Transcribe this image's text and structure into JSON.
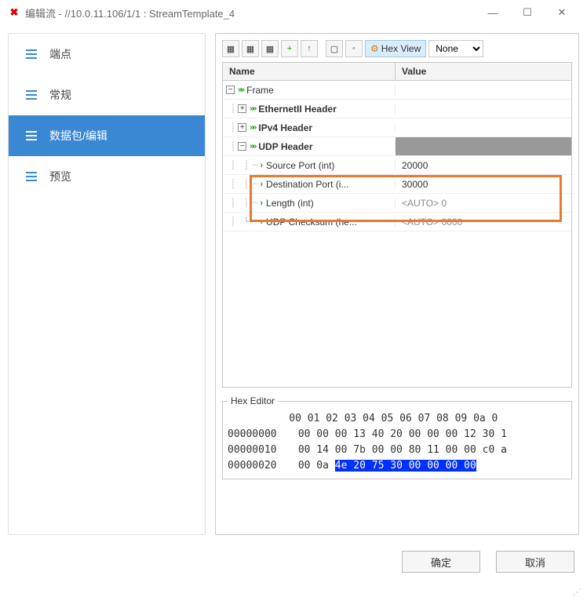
{
  "window": {
    "title": "编辑流 - //10.0.11.106/1/1 : StreamTemplate_4"
  },
  "sidebar": {
    "items": [
      {
        "label": "端点"
      },
      {
        "label": "常规"
      },
      {
        "label": "数据包/编辑"
      },
      {
        "label": "预览"
      }
    ]
  },
  "toolbar": {
    "hexview_label": "Hex View",
    "select_value": "None"
  },
  "table": {
    "headers": {
      "name": "Name",
      "value": "Value"
    },
    "rows": [
      {
        "indent": 0,
        "expander": "-",
        "chevrons": true,
        "name": "Frame",
        "value": "",
        "bold": false
      },
      {
        "indent": 1,
        "expander": "+",
        "chevrons": true,
        "name": "EthernetII Header",
        "value": "",
        "bold": true
      },
      {
        "indent": 1,
        "expander": "+",
        "chevrons": true,
        "name": "IPv4 Header",
        "value": "",
        "bold": true
      },
      {
        "indent": 1,
        "expander": "-",
        "chevrons": true,
        "name": "UDP Header",
        "value": "",
        "bold": true,
        "shaded_value": true
      },
      {
        "indent": 2,
        "chev": true,
        "name": "Source Port (int)",
        "value": "20000"
      },
      {
        "indent": 2,
        "chev": true,
        "name": "Destination Port (i...",
        "value": "30000"
      },
      {
        "indent": 2,
        "chev": true,
        "name": "Length (int)",
        "value": "<AUTO> 0",
        "auto": true
      },
      {
        "indent": 2,
        "chev": true,
        "name": "UDP Checksum (he...",
        "value": "<AUTO> 0000",
        "auto": true
      }
    ]
  },
  "hex": {
    "title": "Hex Editor",
    "header": "          00 01 02 03 04 05 06 07 08 09 0a 0",
    "rows": [
      {
        "addr": "00000000",
        "bytes": "00 00 00 13 40 20 00 00 00 12 30 1"
      },
      {
        "addr": "00000010",
        "bytes": "00 14 00 7b 00 00 80 11 00 00 c0 a"
      },
      {
        "addr": "00000020",
        "prefix": "00 0a ",
        "sel": "4e 20 75 30 00 00 00 00",
        "suffix": ""
      }
    ]
  },
  "footer": {
    "ok": "确定",
    "cancel": "取消"
  }
}
